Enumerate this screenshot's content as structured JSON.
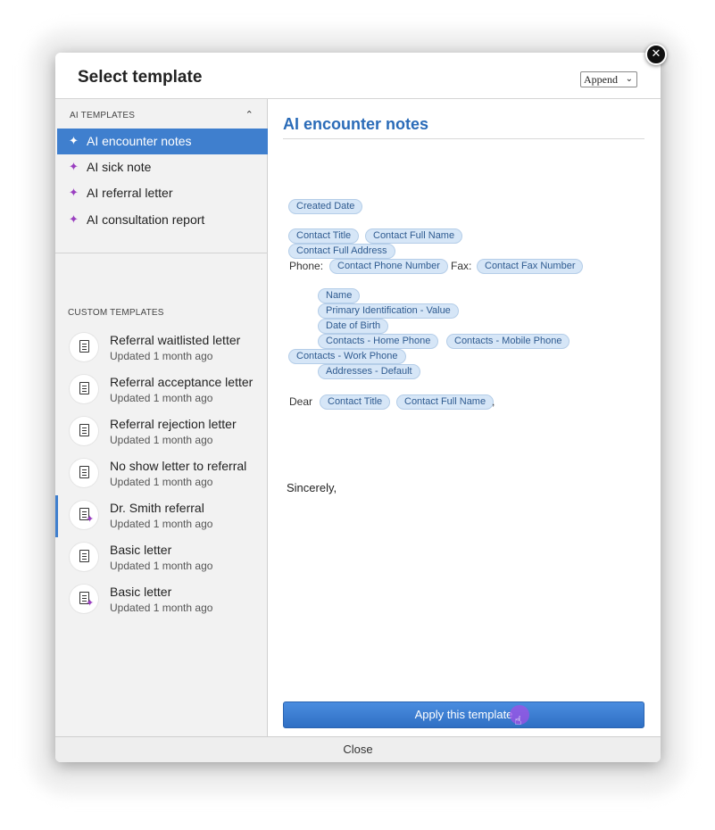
{
  "dialog": {
    "title": "Select template",
    "mode_select": "Append",
    "close_icon": "close-icon"
  },
  "sidebar": {
    "ai_section_label": "AI TEMPLATES",
    "ai_items": [
      {
        "label": "AI encounter notes",
        "active": true
      },
      {
        "label": "AI sick note"
      },
      {
        "label": "AI referral letter"
      },
      {
        "label": "AI consultation report"
      }
    ],
    "custom_section_label": "CUSTOM TEMPLATES",
    "custom_items": [
      {
        "title": "Referral waitlisted letter",
        "updated": "Updated 1 month ago",
        "icon": "document-icon"
      },
      {
        "title": "Referral acceptance letter",
        "updated": "Updated 1 month ago",
        "icon": "document-icon"
      },
      {
        "title": "Referral rejection letter",
        "updated": "Updated 1 month ago",
        "icon": "document-icon"
      },
      {
        "title": "No show letter to referral",
        "updated": "Updated 1 month ago",
        "icon": "document-icon"
      },
      {
        "title": "Dr. Smith referral",
        "updated": "Updated 1 month ago",
        "icon": "ai-document-icon",
        "selected": true
      },
      {
        "title": "Basic letter",
        "updated": "Updated 1 month ago",
        "icon": "document-icon"
      },
      {
        "title": "Basic letter",
        "updated": "Updated 1 month ago",
        "icon": "ai-document-icon"
      }
    ]
  },
  "preview": {
    "title": "AI encounter notes",
    "chips": {
      "created_date": "Created Date",
      "contact_title": "Contact Title",
      "contact_full_name": "Contact Full Name",
      "contact_full_address": "Contact Full Address",
      "contact_phone": "Contact Phone Number",
      "contact_fax": "Contact Fax Number",
      "name": "Name",
      "primary_id": "Primary Identification - Value",
      "dob": "Date of Birth",
      "home_phone": "Contacts - Home Phone",
      "mobile_phone": "Contacts - Mobile Phone",
      "work_phone": "Contacts - Work Phone",
      "addresses": "Addresses - Default"
    },
    "text": {
      "phone": "Phone:",
      "fax": "Fax:",
      "dear": "Dear",
      "comma": ",",
      "sincerely": "Sincerely,"
    },
    "apply_button": "Apply this template"
  },
  "footer": {
    "close_label": "Close"
  }
}
